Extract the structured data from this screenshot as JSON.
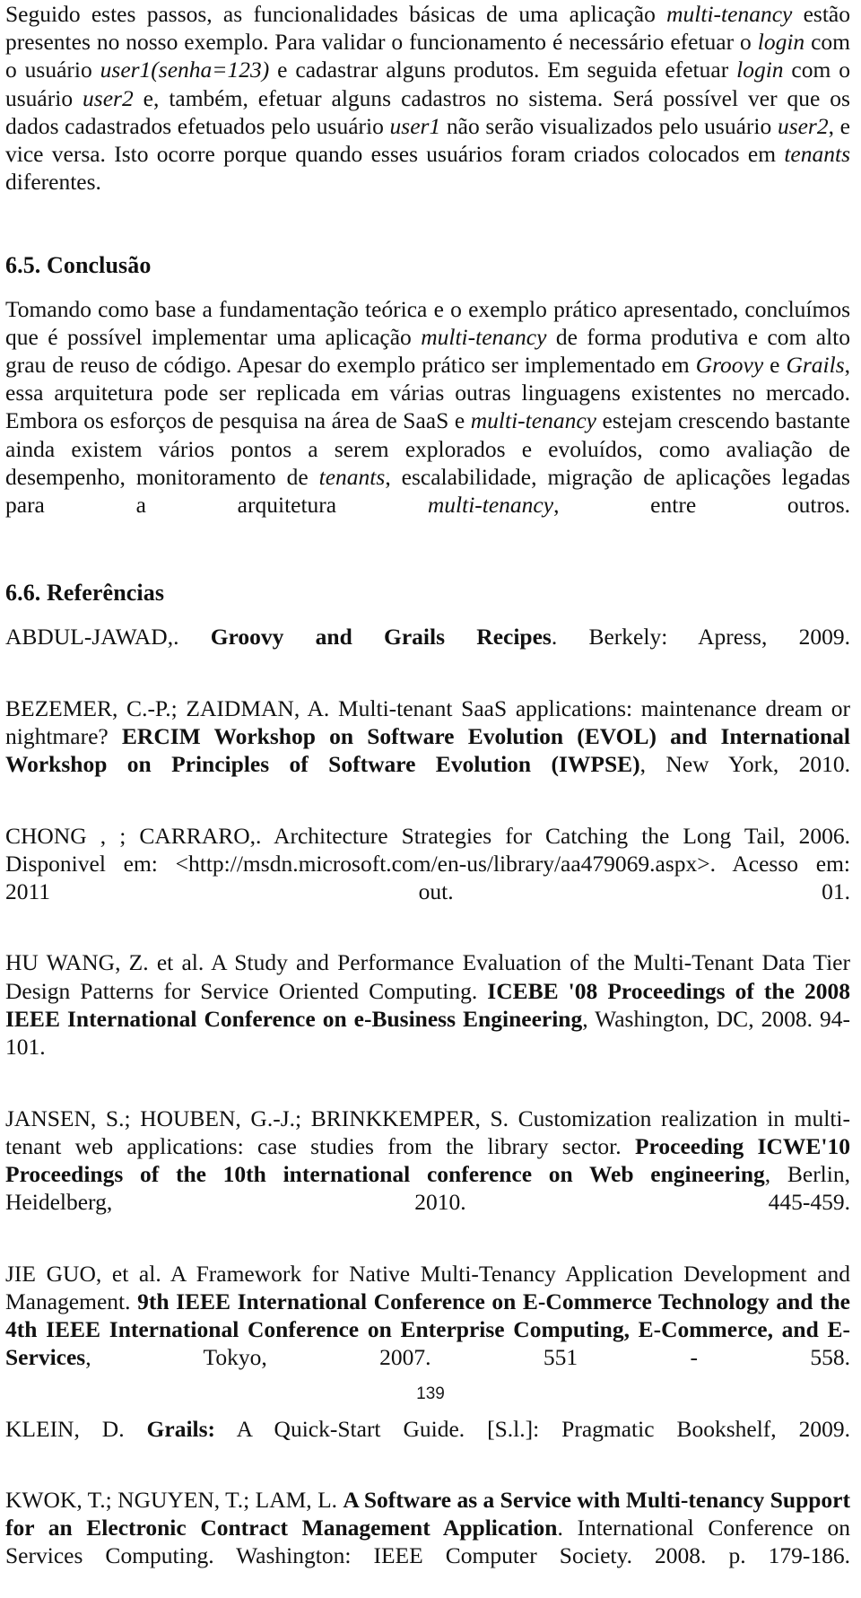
{
  "document": {
    "language": "pt-BR",
    "page_number": "139",
    "text_color": "#111111",
    "background_color": "#ffffff"
  },
  "intro_paragraph": {
    "segments": [
      {
        "text": "Seguido estes passos, as funcionalidades básicas de uma aplicação ",
        "style": "normal"
      },
      {
        "text": "multi-tenancy",
        "style": "italic"
      },
      {
        "text": " estão presentes no nosso exemplo. Para validar o funcionamento é necessário efetuar o ",
        "style": "normal"
      },
      {
        "text": "login",
        "style": "italic"
      },
      {
        "text": " com o usuário ",
        "style": "normal"
      },
      {
        "text": "user1(senha=123)",
        "style": "italic"
      },
      {
        "text": " e cadastrar alguns produtos. Em seguida efetuar ",
        "style": "normal"
      },
      {
        "text": "login",
        "style": "italic"
      },
      {
        "text": " com o usuário ",
        "style": "normal"
      },
      {
        "text": "user2",
        "style": "italic"
      },
      {
        "text": " e, também, efetuar alguns cadastros no sistema. Será possível ver que os dados cadastrados efetuados pelo usuário ",
        "style": "normal"
      },
      {
        "text": "user1",
        "style": "italic"
      },
      {
        "text": " não serão visualizados pelo usuário ",
        "style": "normal"
      },
      {
        "text": "user2",
        "style": "italic"
      },
      {
        "text": ", e vice versa. Isto ocorre porque quando esses usuários foram criados colocados em ",
        "style": "normal"
      },
      {
        "text": "tenants",
        "style": "italic"
      },
      {
        "text": " diferentes.",
        "style": "normal"
      }
    ]
  },
  "conclusion_section": {
    "heading": "6.5. Conclusão",
    "paragraph": {
      "segments": [
        {
          "text": "Tomando como base a fundamentação teórica e o exemplo prático apresentado, concluímos que é possível implementar uma aplicação ",
          "style": "normal"
        },
        {
          "text": "multi-tenancy",
          "style": "italic"
        },
        {
          "text": " de forma produtiva e com alto grau de reuso de código. Apesar do exemplo prático ser implementado em ",
          "style": "normal"
        },
        {
          "text": "Groovy",
          "style": "italic"
        },
        {
          "text": " e ",
          "style": "normal"
        },
        {
          "text": "Grails",
          "style": "italic"
        },
        {
          "text": ", essa arquitetura pode ser replicada em várias outras linguagens existentes no mercado. Embora os esforços de pesquisa na área de SaaS e ",
          "style": "normal"
        },
        {
          "text": "multi-tenancy",
          "style": "italic"
        },
        {
          "text": " estejam crescendo bastante ainda existem vários pontos a serem explorados e evoluídos, como avaliação de desempenho, monitoramento de ",
          "style": "normal"
        },
        {
          "text": "tenants",
          "style": "italic"
        },
        {
          "text": ", escalabilidade, migração de aplicações legadas para a arquitetura ",
          "style": "normal"
        },
        {
          "text": "multi-tenancy",
          "style": "italic"
        },
        {
          "text": ", entre outros.",
          "style": "normal"
        }
      ]
    }
  },
  "references_section": {
    "heading": "6.6. Referências",
    "entries": [
      {
        "id": "abdul-jawad",
        "segments": [
          {
            "text": "ABDUL-JAWAD,. ",
            "style": "normal"
          },
          {
            "text": "Groovy and Grails Recipes",
            "style": "bold"
          },
          {
            "text": ". Berkely: Apress, 2009.",
            "style": "normal"
          }
        ]
      },
      {
        "id": "bezemer-zaidman",
        "segments": [
          {
            "text": "BEZEMER, C.-P.; ZAIDMAN, A. Multi-tenant SaaS applications: maintenance dream or nightmare? ",
            "style": "normal"
          },
          {
            "text": "ERCIM Workshop on Software Evolution (EVOL) and International Workshop on Principles of Software Evolution (IWPSE)",
            "style": "bold"
          },
          {
            "text": ", New York, 2010.",
            "style": "normal"
          }
        ]
      },
      {
        "id": "chong-carraro",
        "segments": [
          {
            "text": "CHONG , ; CARRARO,. Architecture Strategies for Catching the Long Tail, 2006. Disponivel em: <http://msdn.microsoft.com/en-us/library/aa479069.aspx>. Acesso em: 2011 out. 01.",
            "style": "normal"
          }
        ]
      },
      {
        "id": "hu-wang",
        "segments": [
          {
            "text": "HU WANG, Z. et al. A Study and Performance Evaluation of the Multi-Tenant Data Tier Design Patterns for Service Oriented Computing. ",
            "style": "normal"
          },
          {
            "text": "ICEBE '08 Proceedings of the 2008 IEEE International Conference on e-Business Engineering",
            "style": "bold"
          },
          {
            "text": ", Washington, DC, 2008. 94-101.",
            "style": "normal"
          }
        ]
      },
      {
        "id": "jansen-houben-brinkkemper",
        "segments": [
          {
            "text": "JANSEN, S.; HOUBEN, G.-J.; BRINKKEMPER, S. Customization realization in multi-tenant web applications: case studies from the library sector. ",
            "style": "normal"
          },
          {
            "text": "Proceeding ICWE'10 Proceedings of the 10th international conference on Web engineering",
            "style": "bold"
          },
          {
            "text": ", Berlin, Heidelberg, 2010. 445-459.",
            "style": "normal"
          }
        ]
      },
      {
        "id": "jie-guo",
        "segments": [
          {
            "text": "JIE GUO, et al. A Framework for Native Multi-Tenancy Application Development and Management. ",
            "style": "normal"
          },
          {
            "text": "9th IEEE International Conference on E-Commerce Technology and the 4th IEEE International Conference on Enterprise Computing, E-Commerce, and E-Services",
            "style": "bold"
          },
          {
            "text": ", Tokyo, 2007. 551 - 558.",
            "style": "normal"
          }
        ]
      },
      {
        "id": "klein",
        "segments": [
          {
            "text": "KLEIN, D. ",
            "style": "normal"
          },
          {
            "text": "Grails:",
            "style": "bold"
          },
          {
            "text": " A Quick-Start Guide. [S.l.]: Pragmatic Bookshelf, 2009.",
            "style": "normal"
          }
        ]
      },
      {
        "id": "kwok-nguyen-lam",
        "segments": [
          {
            "text": "KWOK, T.; NGUYEN, T.; LAM, L. ",
            "style": "normal"
          },
          {
            "text": "A Software as a Service with Multi-tenancy Support for an Electronic Contract Management Application",
            "style": "bold"
          },
          {
            "text": ". International Conference on Services Computing. Washington: IEEE Computer Society. 2008. p. 179-186.",
            "style": "normal"
          }
        ]
      }
    ]
  }
}
